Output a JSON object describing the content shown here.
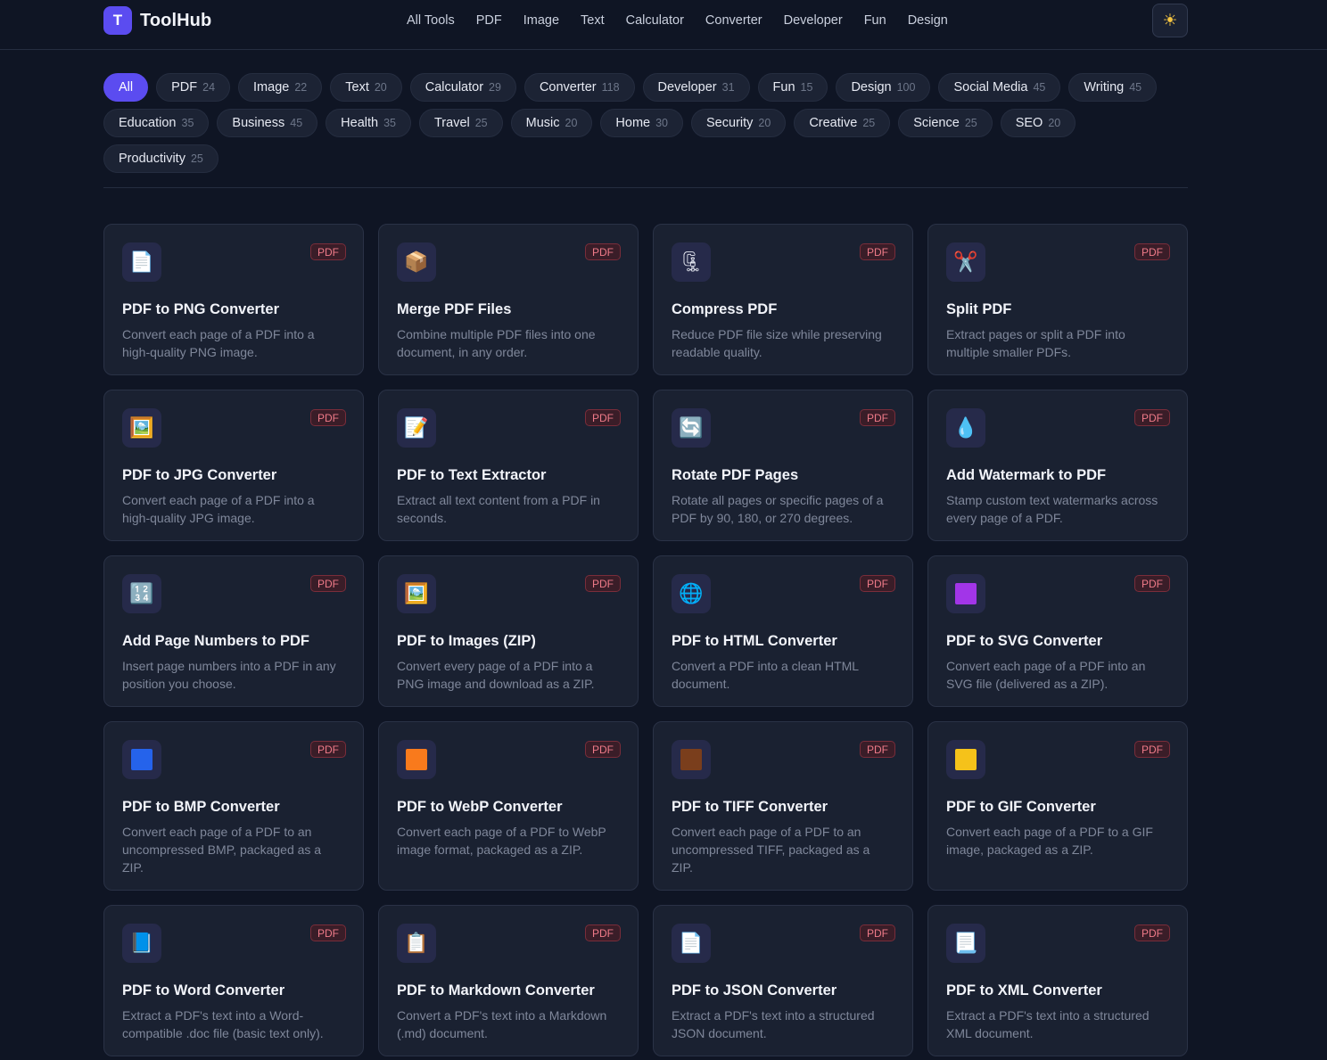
{
  "header": {
    "logo_letter": "T",
    "app_name": "ToolHub",
    "nav": [
      "All Tools",
      "PDF",
      "Image",
      "Text",
      "Calculator",
      "Converter",
      "Developer",
      "Fun",
      "Design"
    ],
    "theme_icon": "sun-icon",
    "theme_glyph": "☀"
  },
  "categories": [
    {
      "label": "All",
      "count": "",
      "active": true
    },
    {
      "label": "PDF",
      "count": "24"
    },
    {
      "label": "Image",
      "count": "22"
    },
    {
      "label": "Text",
      "count": "20"
    },
    {
      "label": "Calculator",
      "count": "29"
    },
    {
      "label": "Converter",
      "count": "118"
    },
    {
      "label": "Developer",
      "count": "31"
    },
    {
      "label": "Fun",
      "count": "15"
    },
    {
      "label": "Design",
      "count": "100"
    },
    {
      "label": "Social Media",
      "count": "45"
    },
    {
      "label": "Writing",
      "count": "45"
    },
    {
      "label": "Education",
      "count": "35"
    },
    {
      "label": "Business",
      "count": "45"
    },
    {
      "label": "Health",
      "count": "35"
    },
    {
      "label": "Travel",
      "count": "25"
    },
    {
      "label": "Music",
      "count": "20"
    },
    {
      "label": "Home",
      "count": "30"
    },
    {
      "label": "Security",
      "count": "20"
    },
    {
      "label": "Creative",
      "count": "25"
    },
    {
      "label": "Science",
      "count": "25"
    },
    {
      "label": "SEO",
      "count": "20"
    },
    {
      "label": "Productivity",
      "count": "25"
    }
  ],
  "colors": {
    "accent": "#5b4cf0",
    "badge_text": "#ee7a88"
  },
  "tools": [
    {
      "title": "PDF to PNG Converter",
      "desc": "Convert each page of a PDF into a high-quality PNG image.",
      "badge": "PDF",
      "icon": "page-icon",
      "glyph": "📄"
    },
    {
      "title": "Merge PDF Files",
      "desc": "Combine multiple PDF files into one document, in any order.",
      "badge": "PDF",
      "icon": "package-icon",
      "glyph": "📦"
    },
    {
      "title": "Compress PDF",
      "desc": "Reduce PDF file size while preserving readable quality.",
      "badge": "PDF",
      "icon": "clamp-icon",
      "glyph": "🗜"
    },
    {
      "title": "Split PDF",
      "desc": "Extract pages or split a PDF into multiple smaller PDFs.",
      "badge": "PDF",
      "icon": "scissors-icon",
      "glyph": "✂️"
    },
    {
      "title": "PDF to JPG Converter",
      "desc": "Convert each page of a PDF into a high-quality JPG image.",
      "badge": "PDF",
      "icon": "picture-icon",
      "glyph": "🖼️"
    },
    {
      "title": "PDF to Text Extractor",
      "desc": "Extract all text content from a PDF in seconds.",
      "badge": "PDF",
      "icon": "memo-icon",
      "glyph": "📝"
    },
    {
      "title": "Rotate PDF Pages",
      "desc": "Rotate all pages or specific pages of a PDF by 90, 180, or 270 degrees.",
      "badge": "PDF",
      "icon": "rotate-icon",
      "glyph": "🔄"
    },
    {
      "title": "Add Watermark to PDF",
      "desc": "Stamp custom text watermarks across every page of a PDF.",
      "badge": "PDF",
      "icon": "droplet-icon",
      "glyph": "💧"
    },
    {
      "title": "Add Page Numbers to PDF",
      "desc": "Insert page numbers into a PDF in any position you choose.",
      "badge": "PDF",
      "icon": "numbers-icon",
      "glyph": "🔢"
    },
    {
      "title": "PDF to Images (ZIP)",
      "desc": "Convert every page of a PDF into a PNG image and download as a ZIP.",
      "badge": "PDF",
      "icon": "picture-icon",
      "glyph": "🖼️"
    },
    {
      "title": "PDF to HTML Converter",
      "desc": "Convert a PDF into a clean HTML document.",
      "badge": "PDF",
      "icon": "globe-icon",
      "glyph": "🌐"
    },
    {
      "title": "PDF to SVG Converter",
      "desc": "Convert each page of a PDF into an SVG file (delivered as a ZIP).",
      "badge": "PDF",
      "icon": "purple-square-icon",
      "color": "#a235e8"
    },
    {
      "title": "PDF to BMP Converter",
      "desc": "Convert each page of a PDF to an uncompressed BMP, packaged as a ZIP.",
      "badge": "PDF",
      "icon": "blue-square-icon",
      "color": "#2563eb"
    },
    {
      "title": "PDF to WebP Converter",
      "desc": "Convert each page of a PDF to WebP image format, packaged as a ZIP.",
      "badge": "PDF",
      "icon": "orange-square-icon",
      "color": "#f97a1c"
    },
    {
      "title": "PDF to TIFF Converter",
      "desc": "Convert each page of a PDF to an uncompressed TIFF, packaged as a ZIP.",
      "badge": "PDF",
      "icon": "brown-square-icon",
      "color": "#7a3e1c"
    },
    {
      "title": "PDF to GIF Converter",
      "desc": "Convert each page of a PDF to a GIF image, packaged as a ZIP.",
      "badge": "PDF",
      "icon": "yellow-square-icon",
      "color": "#f5c21a"
    },
    {
      "title": "PDF to Word Converter",
      "desc": "Extract a PDF's text into a Word-compatible .doc file (basic text only).",
      "badge": "PDF",
      "icon": "blue-book-icon",
      "glyph": "📘"
    },
    {
      "title": "PDF to Markdown Converter",
      "desc": "Convert a PDF's text into a Markdown (.md) document.",
      "badge": "PDF",
      "icon": "clipboard-icon",
      "glyph": "📋"
    },
    {
      "title": "PDF to JSON Converter",
      "desc": "Extract a PDF's text into a structured JSON document.",
      "badge": "PDF",
      "icon": "page-icon",
      "glyph": "📄"
    },
    {
      "title": "PDF to XML Converter",
      "desc": "Extract a PDF's text into a structured XML document.",
      "badge": "PDF",
      "icon": "scroll-icon",
      "glyph": "📃"
    }
  ]
}
